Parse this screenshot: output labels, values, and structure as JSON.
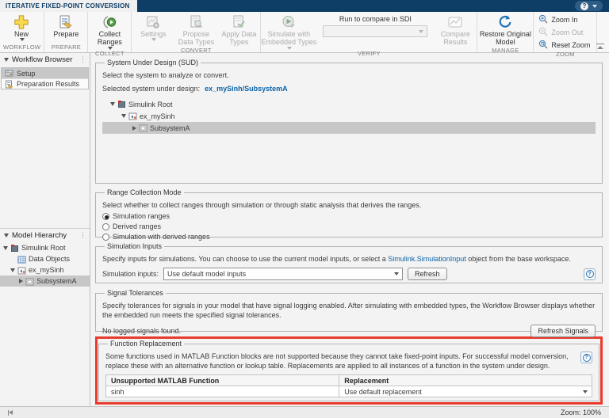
{
  "titlebar": {
    "tab_label": "ITERATIVE FIXED-POINT CONVERSION"
  },
  "icons": {
    "help": "?"
  },
  "toolbar": {
    "workflow": {
      "section_label": "WORKFLOW",
      "new_label": "New"
    },
    "prepare": {
      "section_label": "PREPARE",
      "prepare_label": "Prepare"
    },
    "collect": {
      "section_label": "COLLECT",
      "collect_ranges_label": "Collect Ranges"
    },
    "convert": {
      "section_label": "CONVERT",
      "settings_label": "Settings",
      "propose_label": "Propose Data Types",
      "apply_label": "Apply Data Types"
    },
    "verify": {
      "section_label": "VERIFY",
      "simulate_label": "Simulate with Embedded Types",
      "run_compare_label": "Run to compare in SDI",
      "run_compare_value": "",
      "compare_label": "Compare Results"
    },
    "manage": {
      "section_label": "MANAGE",
      "restore_label": "Restore Original Model"
    },
    "zoom": {
      "section_label": "ZOOM",
      "zoom_in_label": "Zoom In",
      "zoom_out_label": "Zoom Out",
      "reset_zoom_label": "Reset Zoom"
    }
  },
  "sidebar": {
    "workflow_browser": {
      "title": "Workflow Browser",
      "items": [
        {
          "label": "Setup"
        },
        {
          "label": "Preparation Results"
        }
      ]
    },
    "model_hierarchy": {
      "title": "Model Hierarchy",
      "items": [
        {
          "label": "Simulink Root"
        },
        {
          "label": "Data Objects"
        },
        {
          "label": "ex_mySinh"
        },
        {
          "label": "SubsystemA"
        }
      ]
    }
  },
  "sud": {
    "title": "System Under Design (SUD)",
    "description": "Select the system to analyze or convert.",
    "selected_label": "Selected system under design:",
    "selected_value": "ex_mySinh/SubsystemA",
    "tree": [
      {
        "label": "Simulink Root"
      },
      {
        "label": "ex_mySinh"
      },
      {
        "label": "SubsystemA"
      }
    ]
  },
  "range_collection": {
    "title": "Range Collection Mode",
    "description": "Select whether to collect ranges through simulation or through static analysis that derives the ranges.",
    "options": [
      {
        "label": "Simulation ranges"
      },
      {
        "label": "Derived ranges"
      },
      {
        "label": "Simulation with derived ranges"
      }
    ],
    "selected_option": "Simulation ranges"
  },
  "simulation_inputs": {
    "title": "Simulation Inputs",
    "description_pre": "Specify inputs for simulations. You can choose to use the current model inputs, or select a ",
    "description_link": "Simulink.SimulationInput",
    "description_post": " object from the base workspace.",
    "input_label": "Simulation inputs:",
    "input_value": "Use default model inputs",
    "refresh_button": "Refresh"
  },
  "signal_tolerances": {
    "title": "Signal Tolerances",
    "description": "Specify tolerances for signals in your model that have signal logging enabled. After simulating with embedded types, the Workflow Browser displays whether the embedded run meets the specified signal tolerances.",
    "status_text": "No logged signals found.",
    "refresh_button": "Refresh Signals"
  },
  "function_replacement": {
    "title": "Function Replacement",
    "description": "Some functions used in MATLAB Function blocks are not supported because they cannot take fixed-point inputs. For successful model conversion, replace these with an alternative function or lookup table. Replacements are applied to all instances of a function in the system under design.",
    "table": {
      "headers": [
        "Unsupported MATLAB Function",
        "Replacement"
      ],
      "rows": [
        {
          "function": "sinh",
          "replacement": "Use default replacement"
        }
      ]
    }
  },
  "statusbar": {
    "zoom_label": "Zoom: 100%"
  },
  "colors": {
    "accent_navy": "#0e3d66",
    "highlight_red": "#e93a2e",
    "link_blue": "#0b63a8",
    "selection_gray": "#c7c7c7"
  }
}
